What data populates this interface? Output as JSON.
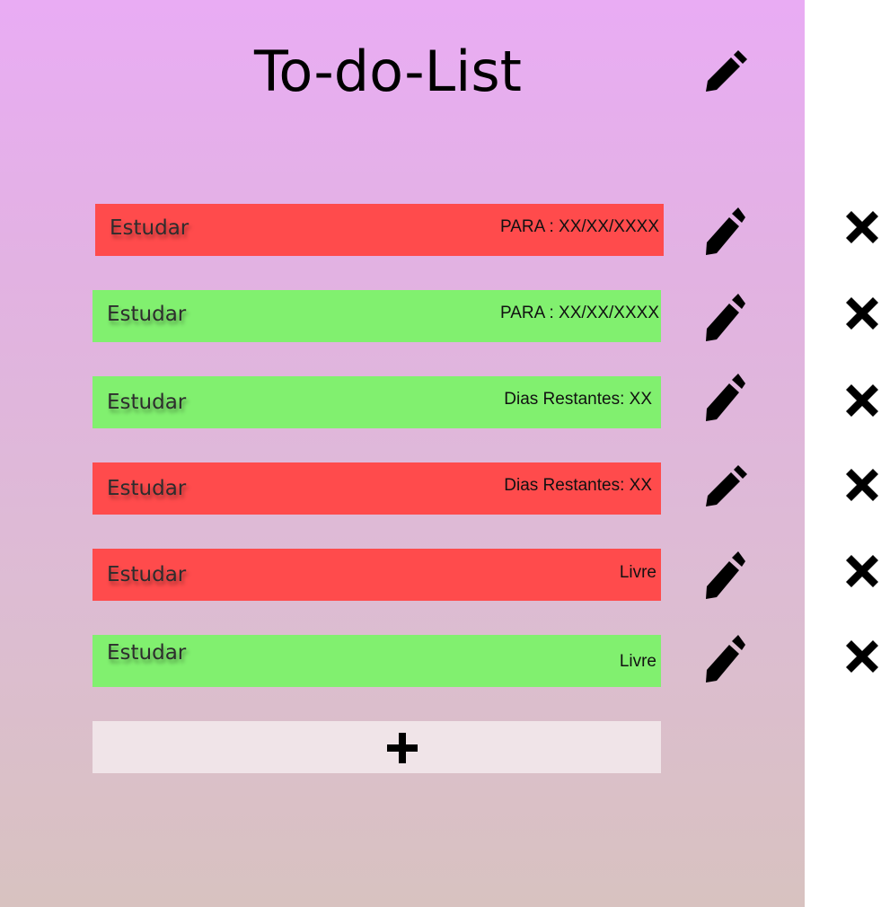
{
  "header": {
    "title": "To-do-List",
    "edit_icon": "pencil-icon"
  },
  "tasks": [
    {
      "name": "Estudar",
      "meta": "PARA : XX/XX/XXXX",
      "status_color": "#ff4b4c"
    },
    {
      "name": "Estudar",
      "meta": "PARA : XX/XX/XXXX",
      "status_color": "#81f06f"
    },
    {
      "name": "Estudar",
      "meta": "Dias Restantes: XX",
      "status_color": "#81f06f"
    },
    {
      "name": "Estudar",
      "meta": "Dias Restantes: XX",
      "status_color": "#ff4b4c"
    },
    {
      "name": "Estudar",
      "meta": "Livre",
      "status_color": "#ff4b4c"
    },
    {
      "name": "Estudar",
      "meta": "Livre",
      "status_color": "#81f06f"
    }
  ],
  "icons": {
    "edit": "pencil-icon",
    "delete": "close-icon",
    "add": "plus-icon"
  },
  "colors": {
    "incomplete": "#ff4b4c",
    "complete": "#81f06f",
    "add_button": "#f0e4e8",
    "gradient_top": "#e9acf4",
    "gradient_bottom": "#d8c2c0"
  }
}
